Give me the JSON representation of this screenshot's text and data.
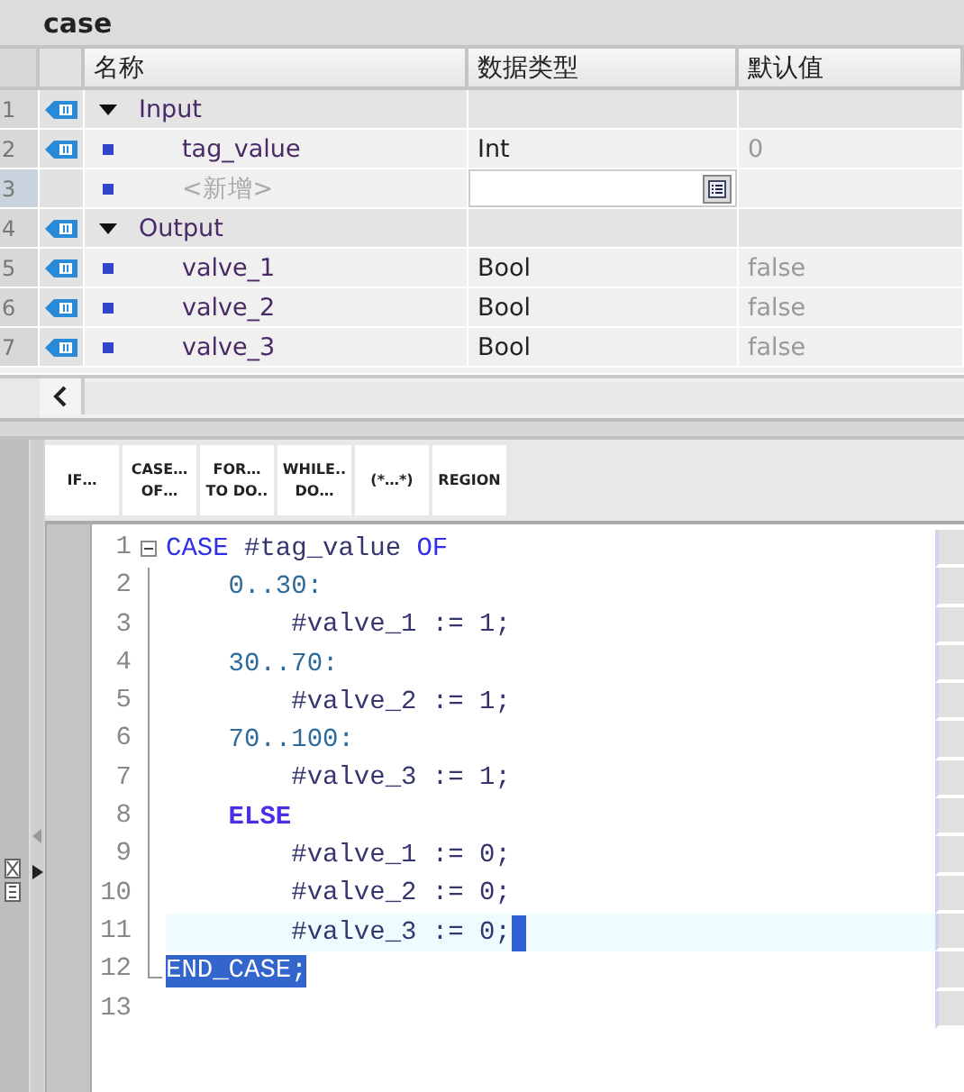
{
  "title": "case",
  "table": {
    "columns": [
      "名称",
      "数据类型",
      "默认值"
    ],
    "rows": [
      {
        "number": "1",
        "kind": "group",
        "expanded": true,
        "interface_icon": true,
        "name": "Input"
      },
      {
        "number": "2",
        "kind": "item",
        "interface_icon": true,
        "name": "tag_value",
        "type": "Int",
        "default": "0"
      },
      {
        "number": "3",
        "kind": "new",
        "interface_icon": false,
        "placeholder": "<新增>"
      },
      {
        "number": "4",
        "kind": "group",
        "expanded": true,
        "interface_icon": true,
        "name": "Output"
      },
      {
        "number": "5",
        "kind": "item",
        "interface_icon": true,
        "name": "valve_1",
        "type": "Bool",
        "default": "false"
      },
      {
        "number": "6",
        "kind": "item",
        "interface_icon": true,
        "name": "valve_2",
        "type": "Bool",
        "default": "false"
      },
      {
        "number": "7",
        "kind": "item",
        "interface_icon": true,
        "name": "valve_3",
        "type": "Bool",
        "default": "false"
      }
    ]
  },
  "toolbar": [
    [
      "IF…"
    ],
    [
      "CASE…",
      "OF…"
    ],
    [
      "FOR…",
      "TO DO.."
    ],
    [
      "WHILE..",
      "DO…"
    ],
    [
      "(*…*)"
    ],
    [
      "REGION"
    ]
  ],
  "code": [
    {
      "number": "1",
      "kind": "fold-start",
      "current": false,
      "selected": false,
      "tokens": [
        {
          "kind": "keyword",
          "text": "CASE "
        },
        {
          "kind": "variable",
          "text": "#tag_value "
        },
        {
          "kind": "keyword",
          "text": "OF"
        }
      ]
    },
    {
      "number": "2",
      "kind": "fold-body",
      "current": false,
      "selected": false,
      "tokens": [
        {
          "kind": "label",
          "text": "    0..30:"
        }
      ]
    },
    {
      "number": "3",
      "kind": "fold-body",
      "current": false,
      "selected": false,
      "tokens": [
        {
          "kind": "variable",
          "text": "        #valve_1 := 1;"
        }
      ]
    },
    {
      "number": "4",
      "kind": "fold-body",
      "current": false,
      "selected": false,
      "tokens": [
        {
          "kind": "label",
          "text": "    30..70:"
        }
      ]
    },
    {
      "number": "5",
      "kind": "fold-body",
      "current": false,
      "selected": false,
      "tokens": [
        {
          "kind": "variable",
          "text": "        #valve_2 := 1;"
        }
      ]
    },
    {
      "number": "6",
      "kind": "fold-body",
      "current": false,
      "selected": false,
      "tokens": [
        {
          "kind": "label",
          "text": "    70..100:"
        }
      ]
    },
    {
      "number": "7",
      "kind": "fold-body",
      "current": false,
      "selected": false,
      "tokens": [
        {
          "kind": "variable",
          "text": "        #valve_3 := 1;"
        }
      ]
    },
    {
      "number": "8",
      "kind": "fold-body",
      "current": false,
      "selected": false,
      "tokens": [
        {
          "kind": "strong",
          "text": "    ELSE"
        }
      ]
    },
    {
      "number": "9",
      "kind": "fold-body",
      "current": false,
      "selected": false,
      "tokens": [
        {
          "kind": "variable",
          "text": "        #valve_1 := 0;"
        }
      ]
    },
    {
      "number": "10",
      "kind": "fold-body",
      "current": false,
      "selected": false,
      "tokens": [
        {
          "kind": "variable",
          "text": "        #valve_2 := 0;"
        }
      ]
    },
    {
      "number": "11",
      "kind": "fold-body",
      "current": true,
      "selected": false,
      "tokens": [
        {
          "kind": "variable",
          "text": "        #valve_3 := 0;"
        }
      ]
    },
    {
      "number": "12",
      "kind": "fold-end",
      "current": false,
      "selected": true,
      "tokens": [
        {
          "kind": "keyword",
          "text": "END_CASE;"
        }
      ]
    },
    {
      "number": "13",
      "kind": "plain",
      "current": false,
      "selected": false
    }
  ]
}
